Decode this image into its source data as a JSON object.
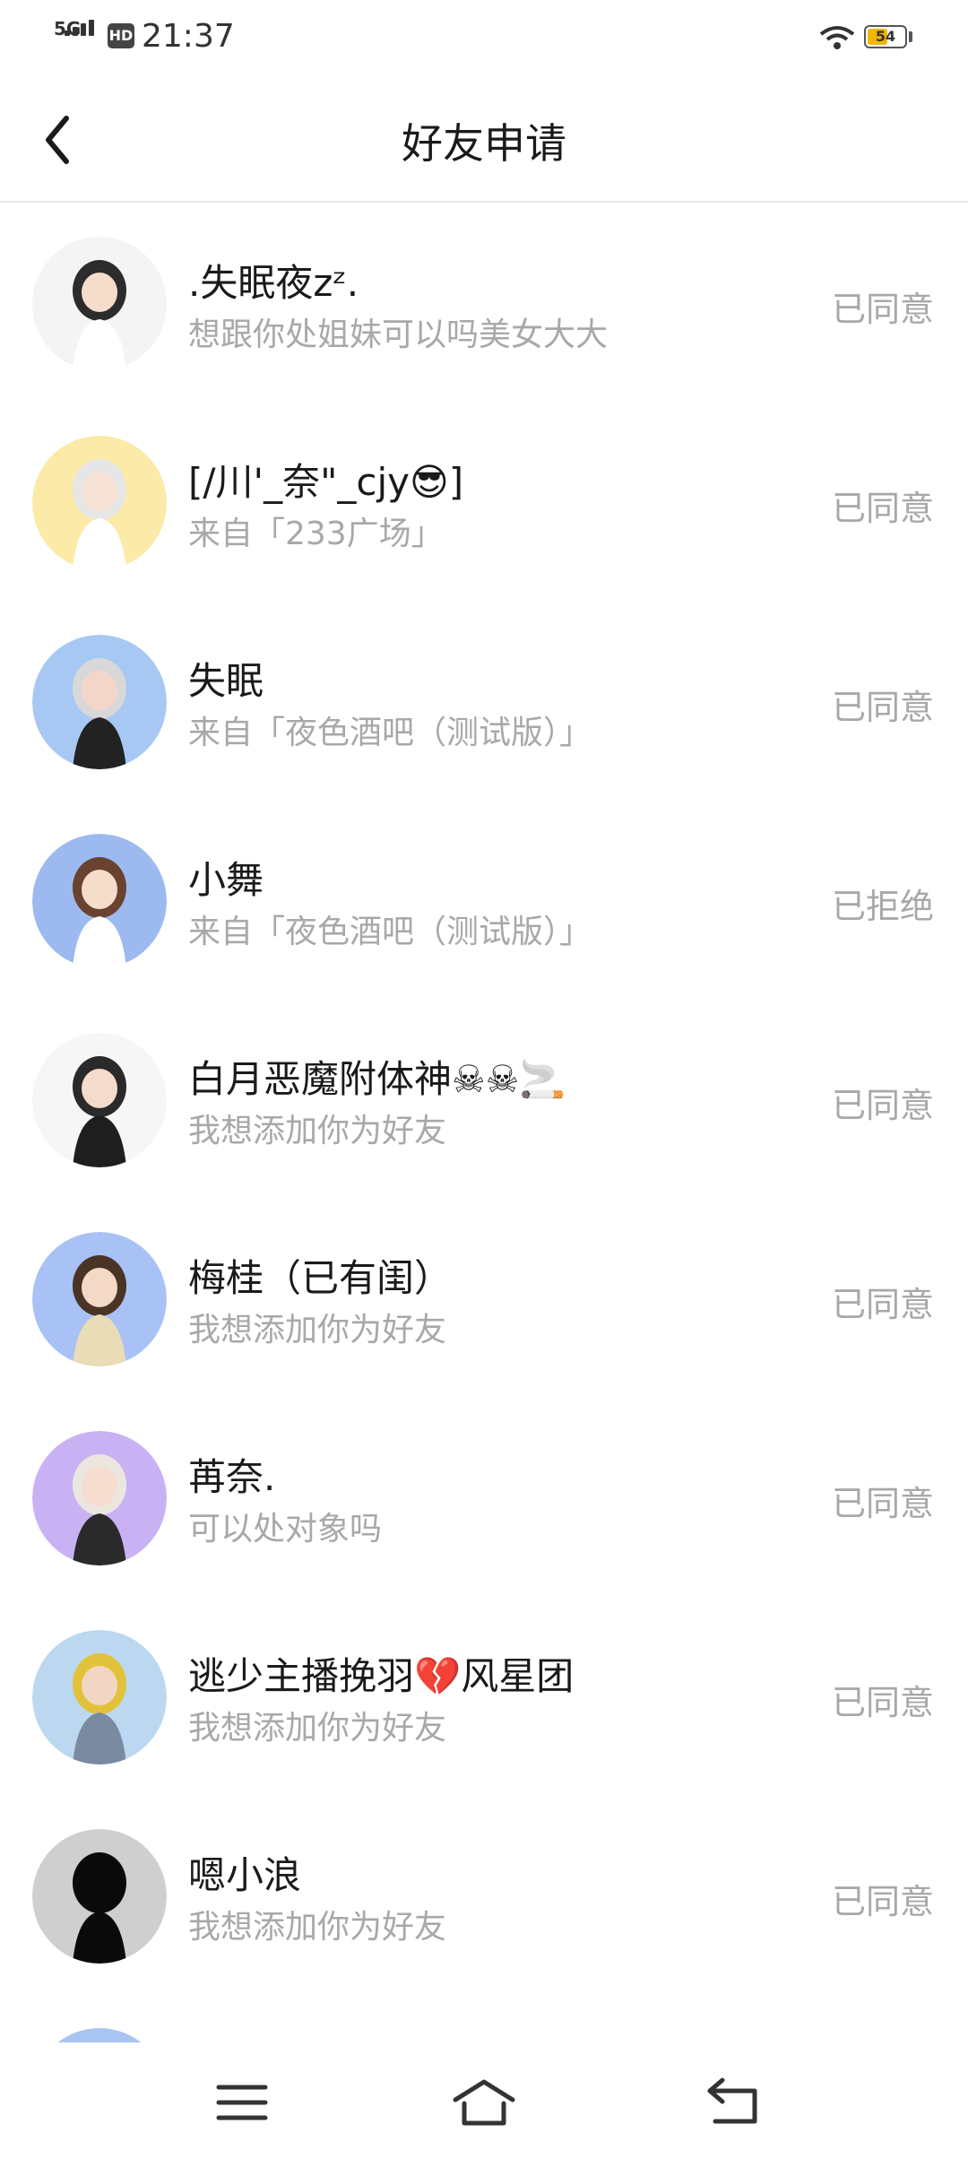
{
  "status_bar": {
    "network": "5G",
    "hd": "HD",
    "time": "21:37",
    "battery": "54",
    "battery_level": 0.54
  },
  "header": {
    "title": "好友申请",
    "back_icon": "chevron-left-icon"
  },
  "requests": [
    {
      "name": ".失眠夜zᶻ.",
      "message": "想跟你处姐妹可以吗美女大大",
      "status": "已同意"
    },
    {
      "name": "[/川'_奈\"_cjy😎]",
      "message": "来自「233广场」",
      "status": "已同意"
    },
    {
      "name": "失眠",
      "message": "来自「夜色酒吧（测试版）」",
      "status": "已同意"
    },
    {
      "name": "小舞",
      "message": "来自「夜色酒吧（测试版）」",
      "status": "已拒绝"
    },
    {
      "name": "白月恶魔附体神☠☠🚬",
      "message": "我想添加你为好友",
      "status": "已同意"
    },
    {
      "name": "梅桂（已有闺）",
      "message": "我想添加你为好友",
      "status": "已同意"
    },
    {
      "name": "苒奈.",
      "message": "可以处对象吗",
      "status": "已同意"
    },
    {
      "name": "逃少主播挽羽💔风星团",
      "message": "我想添加你为好友",
      "status": "已同意"
    },
    {
      "name": "嗯小浪",
      "message": "我想添加你为好友",
      "status": "已同意"
    }
  ],
  "nav_bar": {
    "icons": [
      "menu-icon",
      "home-icon",
      "return-icon"
    ]
  }
}
